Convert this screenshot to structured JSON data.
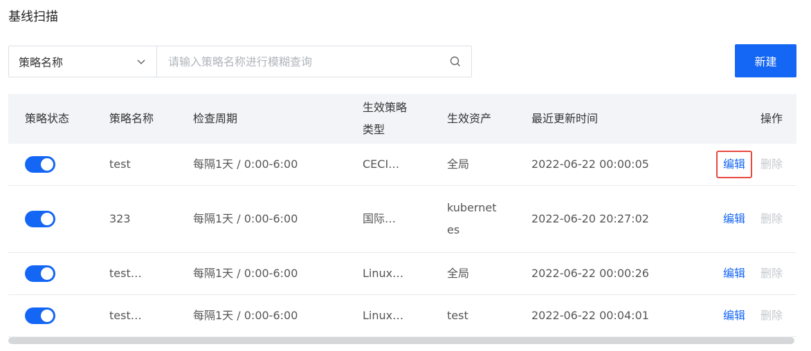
{
  "page": {
    "title": "基线扫描"
  },
  "toolbar": {
    "select_value": "策略名称",
    "search_placeholder": "请输入策略名称进行模糊查询",
    "new_label": "新建"
  },
  "table": {
    "headers": {
      "status": "策略状态",
      "name": "策略名称",
      "period": "检查周期",
      "type_line1": "生效策略",
      "type_line2": "类型",
      "assets": "生效资产",
      "updated": "最近更新时间",
      "actions": "操作"
    },
    "rows": [
      {
        "enabled": true,
        "name": "test",
        "period": "每隔1天 / 0:00-6:00",
        "type": "CECI…",
        "assets": "全局",
        "assets_line2": "",
        "updated": "2022-06-22 00:00:05",
        "edit": "编辑",
        "delete": "删除"
      },
      {
        "enabled": true,
        "name": "323",
        "period": "每隔1天 / 0:00-6:00",
        "type": "国际…",
        "assets": "kubernet",
        "assets_line2": "es",
        "updated": "2022-06-20 20:27:02",
        "edit": "编辑",
        "delete": "删除"
      },
      {
        "enabled": true,
        "name": "test…",
        "period": "每隔1天 / 0:00-6:00",
        "type": "Linux…",
        "assets": "全局",
        "assets_line2": "",
        "updated": "2022-06-22 00:00:26",
        "edit": "编辑",
        "delete": "删除"
      },
      {
        "enabled": true,
        "name": "test…",
        "period": "每隔1天 / 0:00-6:00",
        "type": "Linux…",
        "assets": "test",
        "assets_line2": "",
        "updated": "2022-06-22 00:04:01",
        "edit": "编辑",
        "delete": "删除"
      }
    ]
  },
  "colors": {
    "accent": "#1466f4",
    "highlight_border": "#e8483f",
    "header_bg": "#f2f4f8"
  },
  "icons": {
    "select_chevron": "chevron-down-icon",
    "search": "search-icon"
  }
}
